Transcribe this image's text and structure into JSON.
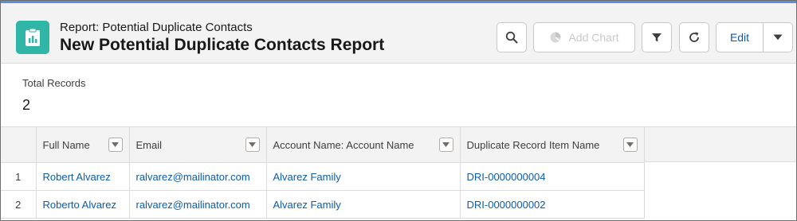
{
  "header": {
    "subtitle": "Report: Potential Duplicate Contacts",
    "title": "New Potential Duplicate Contacts Report",
    "app_icon": "report-icon",
    "accent_color": "#2fb6a7"
  },
  "toolbar": {
    "search_icon": "search-icon",
    "add_chart_label": "Add Chart",
    "add_chart_icon": "chart-icon",
    "filter_icon": "filter-icon",
    "refresh_icon": "refresh-icon",
    "edit_label": "Edit",
    "menu_icon": "chevron-down-icon"
  },
  "summary": {
    "label": "Total Records",
    "value": "2"
  },
  "table": {
    "columns": [
      "Full Name",
      "Email",
      "Account Name: Account Name",
      "Duplicate Record Item Name"
    ],
    "rows": [
      {
        "num": "1",
        "full_name": "Robert Alvarez",
        "email": "ralvarez@mailinator.com",
        "account": "Alvarez Family",
        "dri": "DRI-0000000004"
      },
      {
        "num": "2",
        "full_name": "Roberto Alvarez",
        "email": "ralvarez@mailinator.com",
        "account": "Alvarez Family",
        "dri": "DRI-0000000002"
      }
    ],
    "link_color": "#0b5cab"
  }
}
